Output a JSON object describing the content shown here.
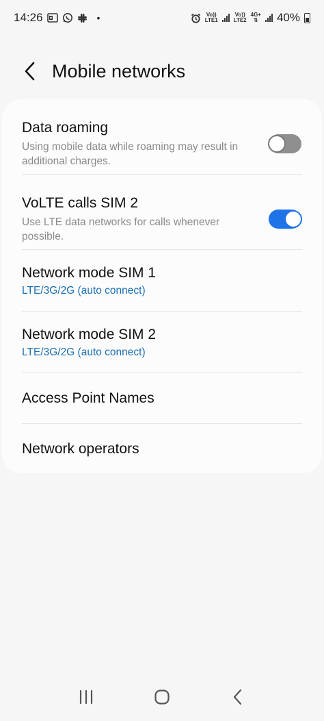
{
  "status_bar": {
    "time": "14:26",
    "dot": "•",
    "sim1_label_top": "Vo))",
    "sim1_label_bottom": "LTE1",
    "sim2_label_top": "Vo))",
    "sim2_label_bottom": "LTE2",
    "net_type": "4G+",
    "battery": "40%"
  },
  "header": {
    "title": "Mobile networks"
  },
  "settings": {
    "data_roaming": {
      "title": "Data roaming",
      "subtitle": "Using mobile data while roaming may result in additional charges.",
      "enabled": false
    },
    "volte": {
      "title": "VoLTE calls SIM 2",
      "subtitle": "Use LTE data networks for calls whenever possible.",
      "enabled": true
    },
    "network_mode_sim1": {
      "title": "Network mode SIM 1",
      "value": "LTE/3G/2G (auto connect)"
    },
    "network_mode_sim2": {
      "title": "Network mode SIM 2",
      "value": "LTE/3G/2G (auto connect)"
    },
    "apn": {
      "title": "Access Point Names"
    },
    "operators": {
      "title": "Network operators"
    }
  },
  "colors": {
    "accent": "#1e73e8",
    "link_blue": "#1a6fb5",
    "background": "#f6f6f6",
    "card": "#fcfcfc"
  }
}
